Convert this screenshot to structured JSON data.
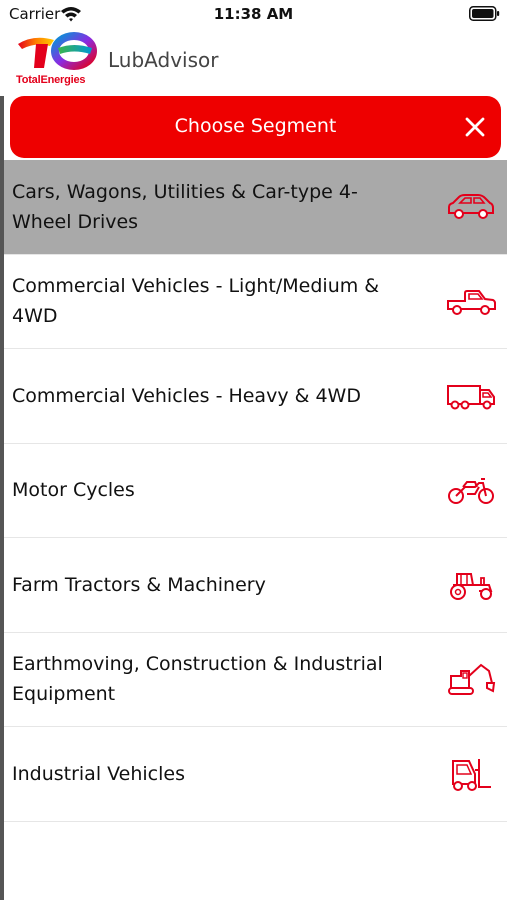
{
  "status_bar": {
    "carrier": "Carrier",
    "time": "11:38 AM"
  },
  "header": {
    "logo_text": "TotalEnergies",
    "app_title": "LubAdvisor"
  },
  "segment_picker": {
    "title": "Choose Segment",
    "close_icon": "close-icon",
    "items": [
      {
        "label": "Cars, Wagons, Utilities & Car-type 4-Wheel Drives",
        "icon": "car-icon",
        "selected": true
      },
      {
        "label": "Commercial Vehicles - Light/Medium & 4WD",
        "icon": "pickup-truck-icon",
        "selected": false
      },
      {
        "label": "Commercial Vehicles - Heavy & 4WD",
        "icon": "heavy-truck-icon",
        "selected": false
      },
      {
        "label": "Motor Cycles",
        "icon": "motorcycle-icon",
        "selected": false
      },
      {
        "label": "Farm Tractors & Machinery",
        "icon": "tractor-icon",
        "selected": false
      },
      {
        "label": "Earthmoving, Construction & Industrial Equipment",
        "icon": "excavator-icon",
        "selected": false
      },
      {
        "label": "Industrial Vehicles",
        "icon": "forklift-icon",
        "selected": false
      }
    ]
  },
  "colors": {
    "accent": "#ee0000",
    "icon": "#e3001b",
    "selected_row": "#a9a9a9"
  }
}
